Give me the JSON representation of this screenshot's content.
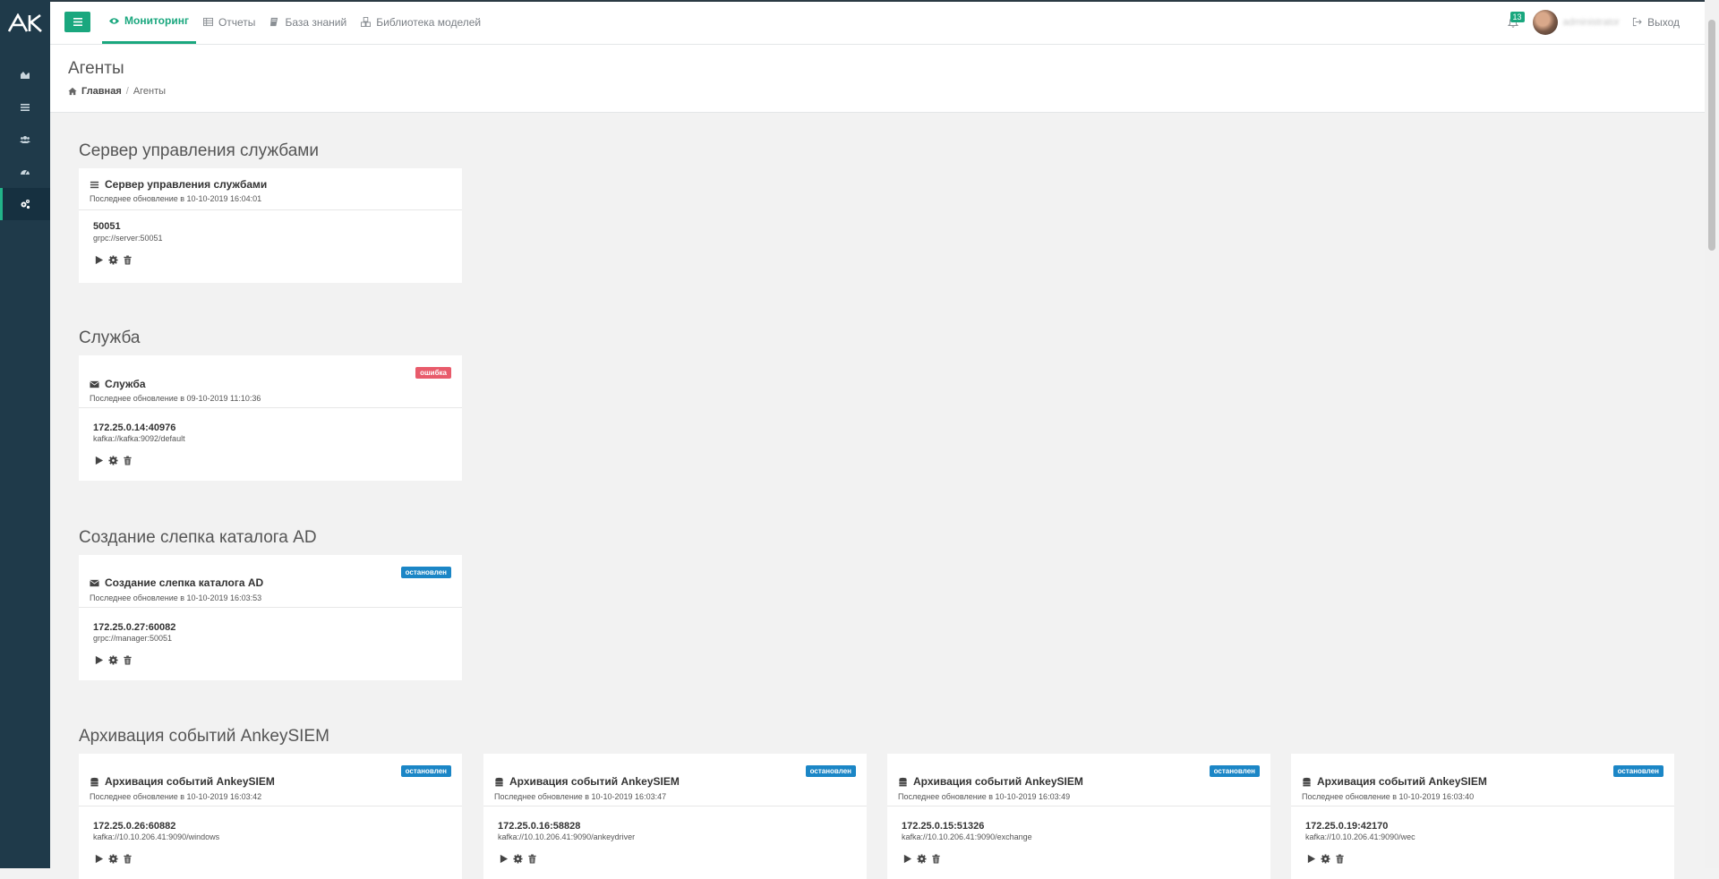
{
  "app": {
    "logo_text": "AK"
  },
  "topnav": {
    "items": [
      {
        "label": "Мониторинг",
        "icon": "eye-icon"
      },
      {
        "label": "Отчеты",
        "icon": "table-icon"
      },
      {
        "label": "База знаний",
        "icon": "book-icon"
      },
      {
        "label": "Библиотека моделей",
        "icon": "cubes-icon"
      }
    ],
    "notification_count": "13",
    "username": "administrator",
    "logout_label": "Выход"
  },
  "sidebar": {
    "items": [
      {
        "icon": "area-chart-icon"
      },
      {
        "icon": "list-icon"
      },
      {
        "icon": "users-icon"
      },
      {
        "icon": "dashboard-icon"
      },
      {
        "icon": "cogs-icon"
      }
    ]
  },
  "page": {
    "title": "Агенты",
    "breadcrumb": {
      "home": "Главная",
      "current": "Агенты"
    }
  },
  "sections": [
    {
      "title": "Сервер управления службами",
      "cards": [
        {
          "title": "Сервер управления службами",
          "icon": "list-icon",
          "updated": "Последнее обновление в 10-10-2019 16:04:01",
          "address": "50051",
          "uri": "grpc://server:50051",
          "status": ""
        }
      ]
    },
    {
      "title": "Служба",
      "cards": [
        {
          "title": "Служба",
          "icon": "envelope-icon",
          "updated": "Последнее обновление в 09-10-2019 11:10:36",
          "address": "172.25.0.14:40976",
          "uri": "kafka://kafka:9092/default",
          "status": "ошибка"
        }
      ]
    },
    {
      "title": "Создание слепка каталога AD",
      "cards": [
        {
          "title": "Создание слепка каталога AD",
          "icon": "envelope-icon",
          "updated": "Последнее обновление в 10-10-2019 16:03:53",
          "address": "172.25.0.27:60082",
          "uri": "grpc://manager:50051",
          "status": "остановлен"
        }
      ]
    },
    {
      "title": "Архивация событий AnkeySIEM",
      "cards": [
        {
          "title": "Архивация событий AnkeySIEM",
          "icon": "database-icon",
          "updated": "Последнее обновление в 10-10-2019 16:03:42",
          "address": "172.25.0.26:60882",
          "uri": "kafka://10.10.206.41:9090/windows",
          "status": "остановлен"
        },
        {
          "title": "Архивация событий AnkeySIEM",
          "icon": "database-icon",
          "updated": "Последнее обновление в 10-10-2019 16:03:47",
          "address": "172.25.0.16:58828",
          "uri": "kafka://10.10.206.41:9090/ankeydriver",
          "status": "остановлен"
        },
        {
          "title": "Архивация событий AnkeySIEM",
          "icon": "database-icon",
          "updated": "Последнее обновление в 10-10-2019 16:03:49",
          "address": "172.25.0.15:51326",
          "uri": "kafka://10.10.206.41:9090/exchange",
          "status": "остановлен"
        },
        {
          "title": "Архивация событий AnkeySIEM",
          "icon": "database-icon",
          "updated": "Последнее обновление в 10-10-2019 16:03:40",
          "address": "172.25.0.19:42170",
          "uri": "kafka://10.10.206.41:9090/wec",
          "status": "остановлен"
        }
      ]
    }
  ],
  "colors": {
    "accent": "#1aa77e",
    "sidebar": "#1f3a4a",
    "error": "#e85b6b",
    "stopped": "#1b86c6"
  }
}
